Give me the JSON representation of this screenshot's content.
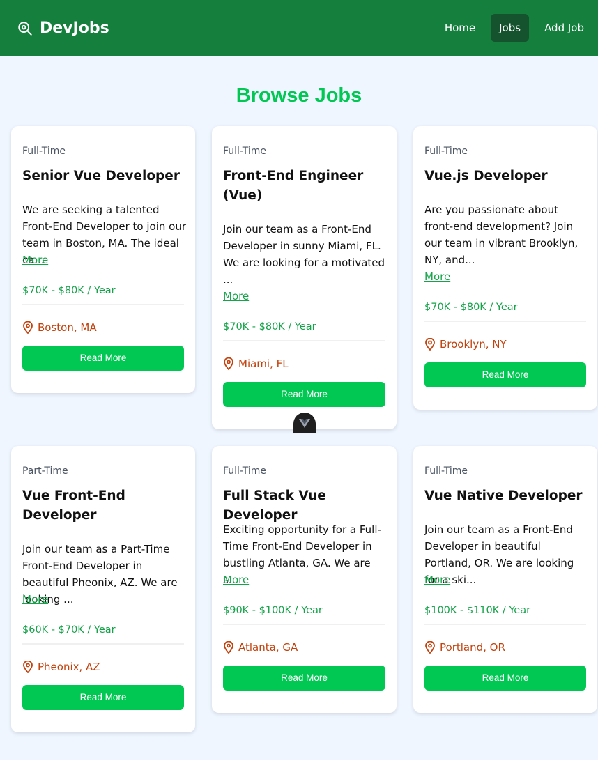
{
  "nav": {
    "brand": "DevJobs",
    "links": [
      {
        "label": "Home",
        "active": false
      },
      {
        "label": "Jobs",
        "active": true
      },
      {
        "label": "Add Job",
        "active": false
      }
    ]
  },
  "page": {
    "heading": "Browse Jobs"
  },
  "colors": {
    "nav_bg": "#15803d",
    "accent": "#00c853",
    "location": "#c2410c",
    "page_bg": "#eff6ff"
  },
  "jobs": [
    {
      "type": "Full-Time",
      "title": "Senior Vue Developer",
      "description": "We are seeking a talented Front-End Developer to join our team in Boston, MA. The ideal ca...",
      "more_label": "More",
      "salary": "$70K - $80K / Year",
      "location": "Boston, MA",
      "button": "Read More"
    },
    {
      "type": "Full-Time",
      "title": "Front-End Engineer (Vue)",
      "description": "Join our team as a Front-End Developer in sunny Miami, FL. We are looking for a motivated ...",
      "more_label": "More",
      "salary": "$70K - $80K / Year",
      "location": "Miami, FL",
      "button": "Read More"
    },
    {
      "type": "Full-Time",
      "title": "Vue.js Developer",
      "description": "Are you passionate about front-end development? Join our team in vibrant Brooklyn, NY, and...",
      "more_label": "More",
      "salary": "$70K - $80K / Year",
      "location": "Brooklyn, NY",
      "button": "Read More"
    },
    {
      "type": "Part-Time",
      "title": "Vue Front-End Developer",
      "description": "Join our team as a Part-Time Front-End Developer in beautiful Pheonix, AZ. We are looking ...",
      "more_label": "More",
      "salary": "$60K - $70K / Year",
      "location": "Pheonix, AZ",
      "button": "Read More"
    },
    {
      "type": "Full-Time",
      "title": "Full Stack Vue Developer",
      "description": "Exciting opportunity for a Full-Time Front-End Developer in bustling Atlanta, GA. We are s...",
      "more_label": "More",
      "salary": "$90K - $100K / Year",
      "location": "Atlanta, GA",
      "button": "Read More"
    },
    {
      "type": "Full-Time",
      "title": "Vue Native Developer",
      "description": "Join our team as a Front-End Developer in beautiful Portland, OR. We are looking for a ski...",
      "more_label": "More",
      "salary": "$100K - $110K / Year",
      "location": "Portland, OR",
      "button": "Read More"
    }
  ]
}
